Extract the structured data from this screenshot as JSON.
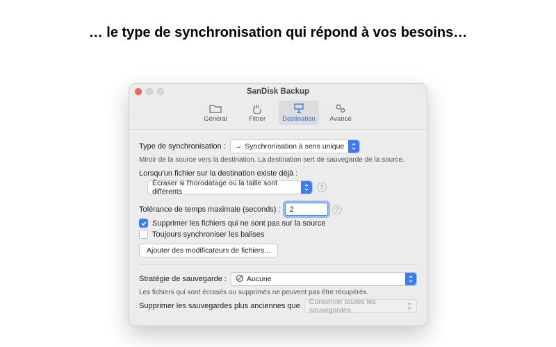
{
  "headline": "… le type de synchronisation qui répond à vos besoins…",
  "window": {
    "title": "SanDisk Backup",
    "toolbar": {
      "general": "Général",
      "filter": "Filtrer",
      "destination": "Destination",
      "advanced": "Avancé",
      "selected": "destination"
    },
    "sync_type_label": "Type de synchronisation :",
    "sync_type_value": "Synchronisation à sens unique",
    "sync_type_hint": "Miroir de la source vers la destination. La destination sert de sauvegarde de la source.",
    "exists_label": "Lorsqu'un fichier sur la destination existe déjà :",
    "exists_value": "Écraser si l'horodatage ou la taille sont différents",
    "tolerance_label": "Tolérance de temps maximale (seconds) :",
    "tolerance_value": "2",
    "delete_orphans": "Supprimer les fichiers qui ne sont pas sur la source",
    "always_sync_tags": "Toujours synchroniser les balises",
    "add_modifiers": "Ajouter des modificateurs de fichiers...",
    "strategy_label": "Stratégie de sauvegarde :",
    "strategy_value": "Aucune",
    "strategy_hint": "Les fichiers qui sont écrasés ou supprimés ne peuvent pas être récupérés.",
    "prune_label": "Supprimer les sauvegardes plus anciennes que",
    "prune_value": "Conserver toutes les sauvegardes",
    "help": "?"
  }
}
